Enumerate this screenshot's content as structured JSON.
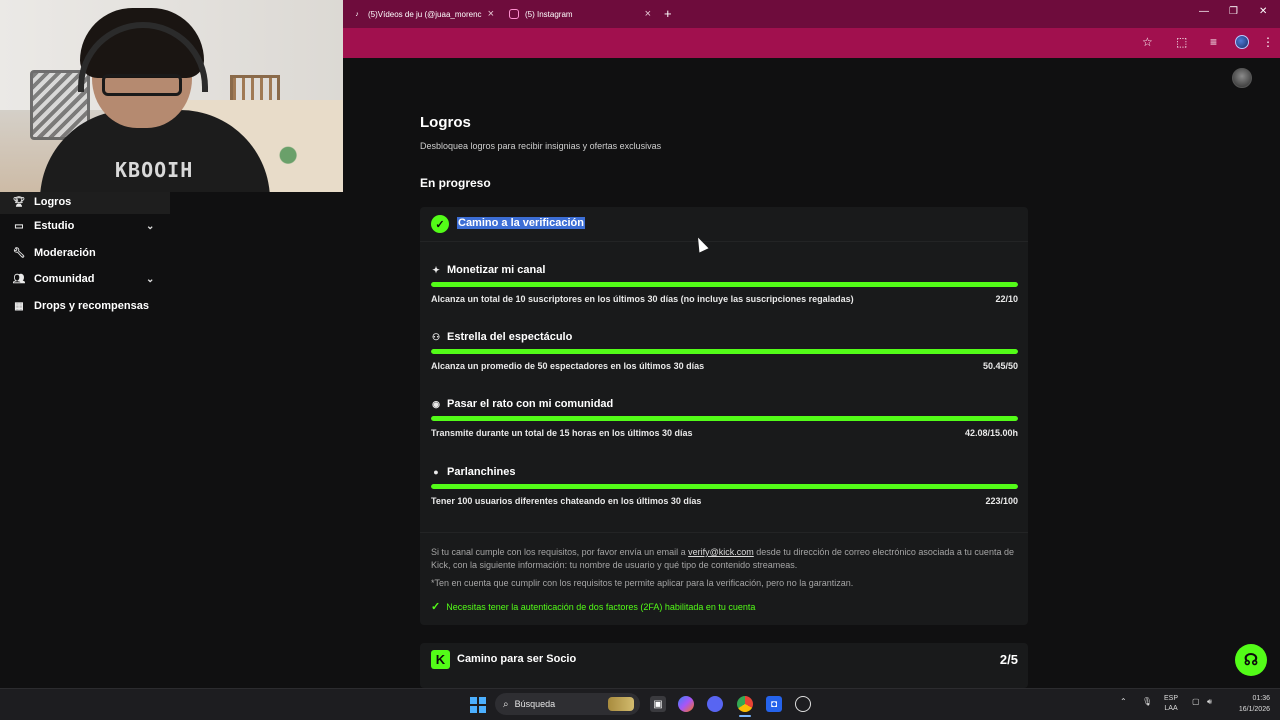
{
  "browser": {
    "tabs": [
      {
        "label": "(5)Vídeos de ju (@juaa_morenc",
        "favicon": "tiktok-icon"
      },
      {
        "label": "(5) Instagram",
        "favicon": "instagram-icon"
      }
    ],
    "new_tab_label": "+",
    "colors": {
      "tabbar": "#6e0c3c",
      "toolbar": "#a1104e"
    }
  },
  "webcam": {
    "shirt_text": "KBOOIH"
  },
  "sidebar": {
    "items": [
      {
        "label": "Logros",
        "icon": "trophy-icon",
        "expandable": false,
        "active": true
      },
      {
        "label": "Estudio",
        "icon": "monitor-icon",
        "expandable": true,
        "active": false
      },
      {
        "label": "Moderación",
        "icon": "wrench-icon",
        "expandable": false,
        "active": false
      },
      {
        "label": "Comunidad",
        "icon": "users-icon",
        "expandable": true,
        "active": false
      },
      {
        "label": "Drops y recompensas",
        "icon": "gift-icon",
        "expandable": false,
        "active": false
      }
    ]
  },
  "main": {
    "title": "Logros",
    "subtitle": "Desbloquea logros para recibir insignias y ofertas exclusivas",
    "section_title": "En progreso",
    "card": {
      "title": "Camino a la verificación",
      "requirements": [
        {
          "name": "Monetizar mi canal",
          "icon": "sparkle-icon",
          "desc": "Alcanza un total de 10 suscriptores en los últimos 30 días (no incluye las suscripciones regaladas)",
          "value": "22/10",
          "progress": 1.0
        },
        {
          "name": "Estrella del espectáculo",
          "icon": "people-icon",
          "desc": "Alcanza un promedio de 50 espectadores en los últimos 30 días",
          "value": "50.45/50",
          "progress": 1.0
        },
        {
          "name": "Pasar el rato con mi comunidad",
          "icon": "broadcast-icon",
          "desc": "Transmite durante un total de 15 horas en los últimos 30 días",
          "value": "42.08/15.00h",
          "progress": 1.0
        },
        {
          "name": "Parlanchines",
          "icon": "chat-icon",
          "desc": "Tener 100 usuarios diferentes chateando en los últimos 30 días",
          "value": "223/100",
          "progress": 1.0
        }
      ],
      "info_pre": "Si tu canal cumple con los requisitos, por favor envía un email a ",
      "info_link": "verify@kick.com",
      "info_post": " desde tu dirección de correo electrónico asociada a tu cuenta de Kick, con la siguiente información: tu nombre de usuario y qué tipo de contenido streameas.",
      "disclaimer": "*Ten en cuenta que cumplir con los requisitos te permite aplicar para la verificación, pero no la garantizan.",
      "twofa_note": "Necesitas tener la autenticación de dos factores (2FA) habilitada en tu cuenta"
    },
    "card2": {
      "title": "Camino para ser Socio",
      "badge": "K",
      "count": "2/5"
    },
    "accent_color": "#53fc18"
  },
  "taskbar": {
    "search_placeholder": "Búsqueda",
    "lang": [
      "ESP",
      "LAA"
    ],
    "time": "01:36",
    "date": "16/1/2026"
  }
}
